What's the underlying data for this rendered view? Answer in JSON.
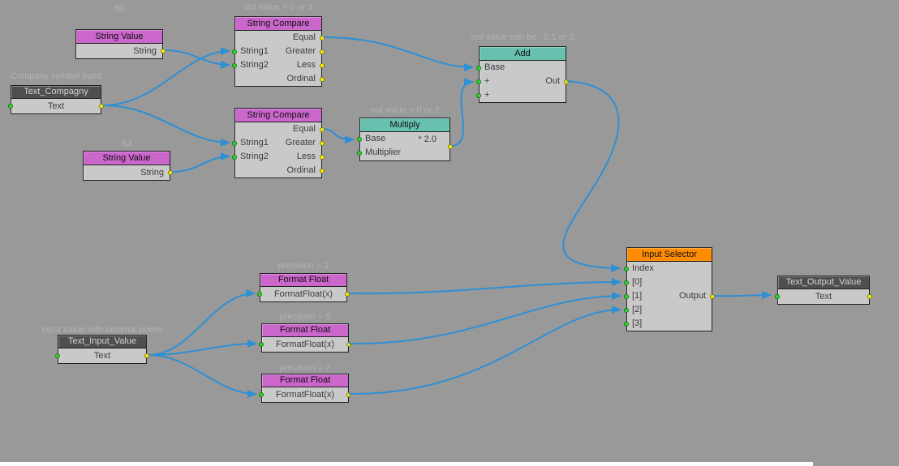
{
  "canvas": {
    "colors": {
      "background": "#999999",
      "node_body": "#c9c9c9",
      "node_border": "#222222",
      "header_magenta": "#cb66cb",
      "header_teal": "#68c0ae",
      "header_orange": "#ff8c00",
      "header_dark": "#4f4f4f",
      "wire": "#2e8fd4",
      "port_output": "#ffee00",
      "port_input": "#33d633",
      "comment_text": "#b3b3b3"
    }
  },
  "nodes": {
    "string_value_1": {
      "comment": "6B",
      "title": "String Value",
      "output": "String"
    },
    "string_compare_1": {
      "comment": "out value = 0 or 1",
      "title": "String Compare",
      "inputs": [
        "String1",
        "String2"
      ],
      "outputs": [
        "Equal",
        "Greater",
        "Less",
        "Ordinal"
      ]
    },
    "text_compagny": {
      "comment": "Company symbol input",
      "title": "Text_Compagny",
      "value": "Text"
    },
    "string_value_2": {
      "comment": "6J",
      "title": "String Value",
      "output": "String"
    },
    "string_compare_2": {
      "title": "String Compare",
      "inputs": [
        "String1",
        "String2"
      ],
      "outputs": [
        "Equal",
        "Greater",
        "Less",
        "Ordinal"
      ]
    },
    "multiply": {
      "comment": "out value = 0 or 2",
      "title": "Multiply",
      "inputs": [
        "Base",
        "Multiplier"
      ],
      "factor": "* 2.0"
    },
    "add": {
      "comment": "out value can be : 0 1 or 2",
      "title": "Add",
      "inputs": [
        "Base",
        "+",
        "+"
      ],
      "output": "Out"
    },
    "format_float_1": {
      "comment": "precision = 2",
      "title": "Format Float",
      "body": "FormatFloat(x)"
    },
    "format_float_2": {
      "comment": "precision = 5",
      "title": "Format Float",
      "body": "FormatFloat(x)"
    },
    "format_float_3": {
      "comment": "precision = 7",
      "title": "Format Float",
      "body": "FormatFloat(x)"
    },
    "text_input_value": {
      "comment": "input value with decimal points",
      "title": "Text_Input_Value",
      "value": "Text"
    },
    "input_selector": {
      "title": "Input Selector",
      "inputs": [
        "Index",
        "[0]",
        "[1]",
        "[2]",
        "[3]"
      ],
      "output": "Output"
    },
    "text_output_value": {
      "title": "Text_Output_Value",
      "value": "Text"
    }
  },
  "connections": [
    {
      "from": "Text_Compagny.Text",
      "to": "String Compare 1.String1"
    },
    {
      "from": "String Value 1.String",
      "to": "String Compare 1.String2"
    },
    {
      "from": "Text_Compagny.Text",
      "to": "String Compare 2.String1"
    },
    {
      "from": "String Value 2.String",
      "to": "String Compare 2.String2"
    },
    {
      "from": "String Compare 1.Equal",
      "to": "Add.Base"
    },
    {
      "from": "String Compare 2.Equal",
      "to": "Multiply.Base"
    },
    {
      "from": "Multiply.Out",
      "to": "Add.+"
    },
    {
      "from": "Add.Out",
      "to": "Input Selector.Index"
    },
    {
      "from": "Format Float 1.Out",
      "to": "Input Selector.[0]"
    },
    {
      "from": "Format Float 2.Out",
      "to": "Input Selector.[1]"
    },
    {
      "from": "Format Float 3.Out",
      "to": "Input Selector.[2]"
    },
    {
      "from": "Text_Input_Value.Text",
      "to": "Format Float 1.In"
    },
    {
      "from": "Text_Input_Value.Text",
      "to": "Format Float 2.In"
    },
    {
      "from": "Text_Input_Value.Text",
      "to": "Format Float 3.In"
    },
    {
      "from": "Input Selector.Output",
      "to": "Text_Output_Value.Text"
    }
  ]
}
